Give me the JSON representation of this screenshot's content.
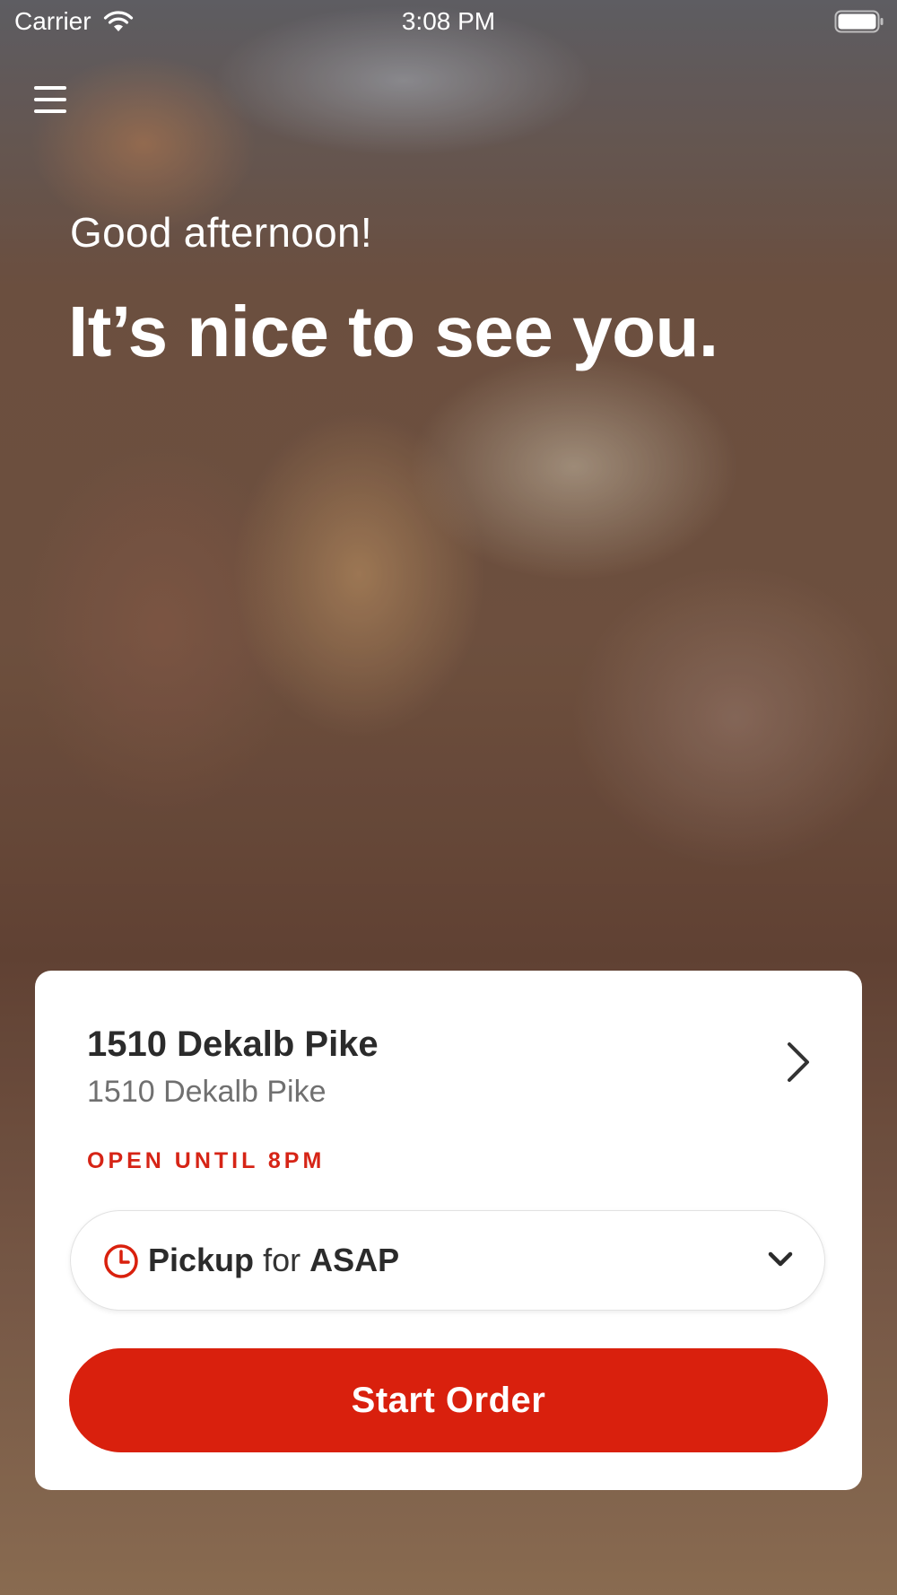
{
  "status_bar": {
    "carrier": "Carrier",
    "time": "3:08 PM"
  },
  "header": {
    "menu_icon": "hamburger-menu-icon"
  },
  "greeting": {
    "salutation": "Good afternoon!",
    "message": "It’s nice to see you."
  },
  "location_card": {
    "name": "1510 Dekalb Pike",
    "address": "1510 Dekalb Pike",
    "status": "OPEN UNTIL 8PM",
    "order_type": {
      "mode": "Pickup",
      "connector": "for",
      "time": "ASAP"
    },
    "start_order_label": "Start Order"
  },
  "colors": {
    "accent": "#d9200d",
    "status_text": "#d62416",
    "card_background": "#ffffff"
  },
  "icons": {
    "wifi": "wifi-icon",
    "battery": "battery-icon",
    "chevron": "chevron-right-icon",
    "clock": "clock-icon",
    "dropdown": "chevron-down-icon"
  }
}
